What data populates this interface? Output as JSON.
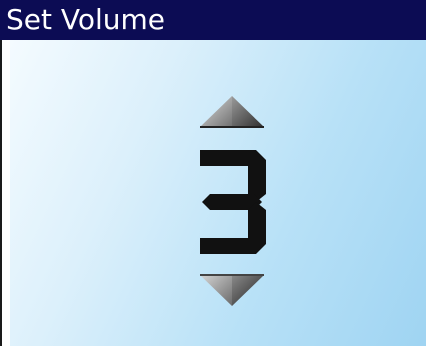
{
  "dialog": {
    "title": "Set Volume"
  },
  "volume": {
    "value": "3"
  },
  "icons": {
    "increase": "triangle-up-icon",
    "decrease": "triangle-down-icon"
  },
  "colors": {
    "titlebar": "#0c0c54",
    "title_text": "#ffffff",
    "panel_light": "#f4fbff",
    "panel_dark": "#9fd4f2",
    "digit": "#111111"
  }
}
